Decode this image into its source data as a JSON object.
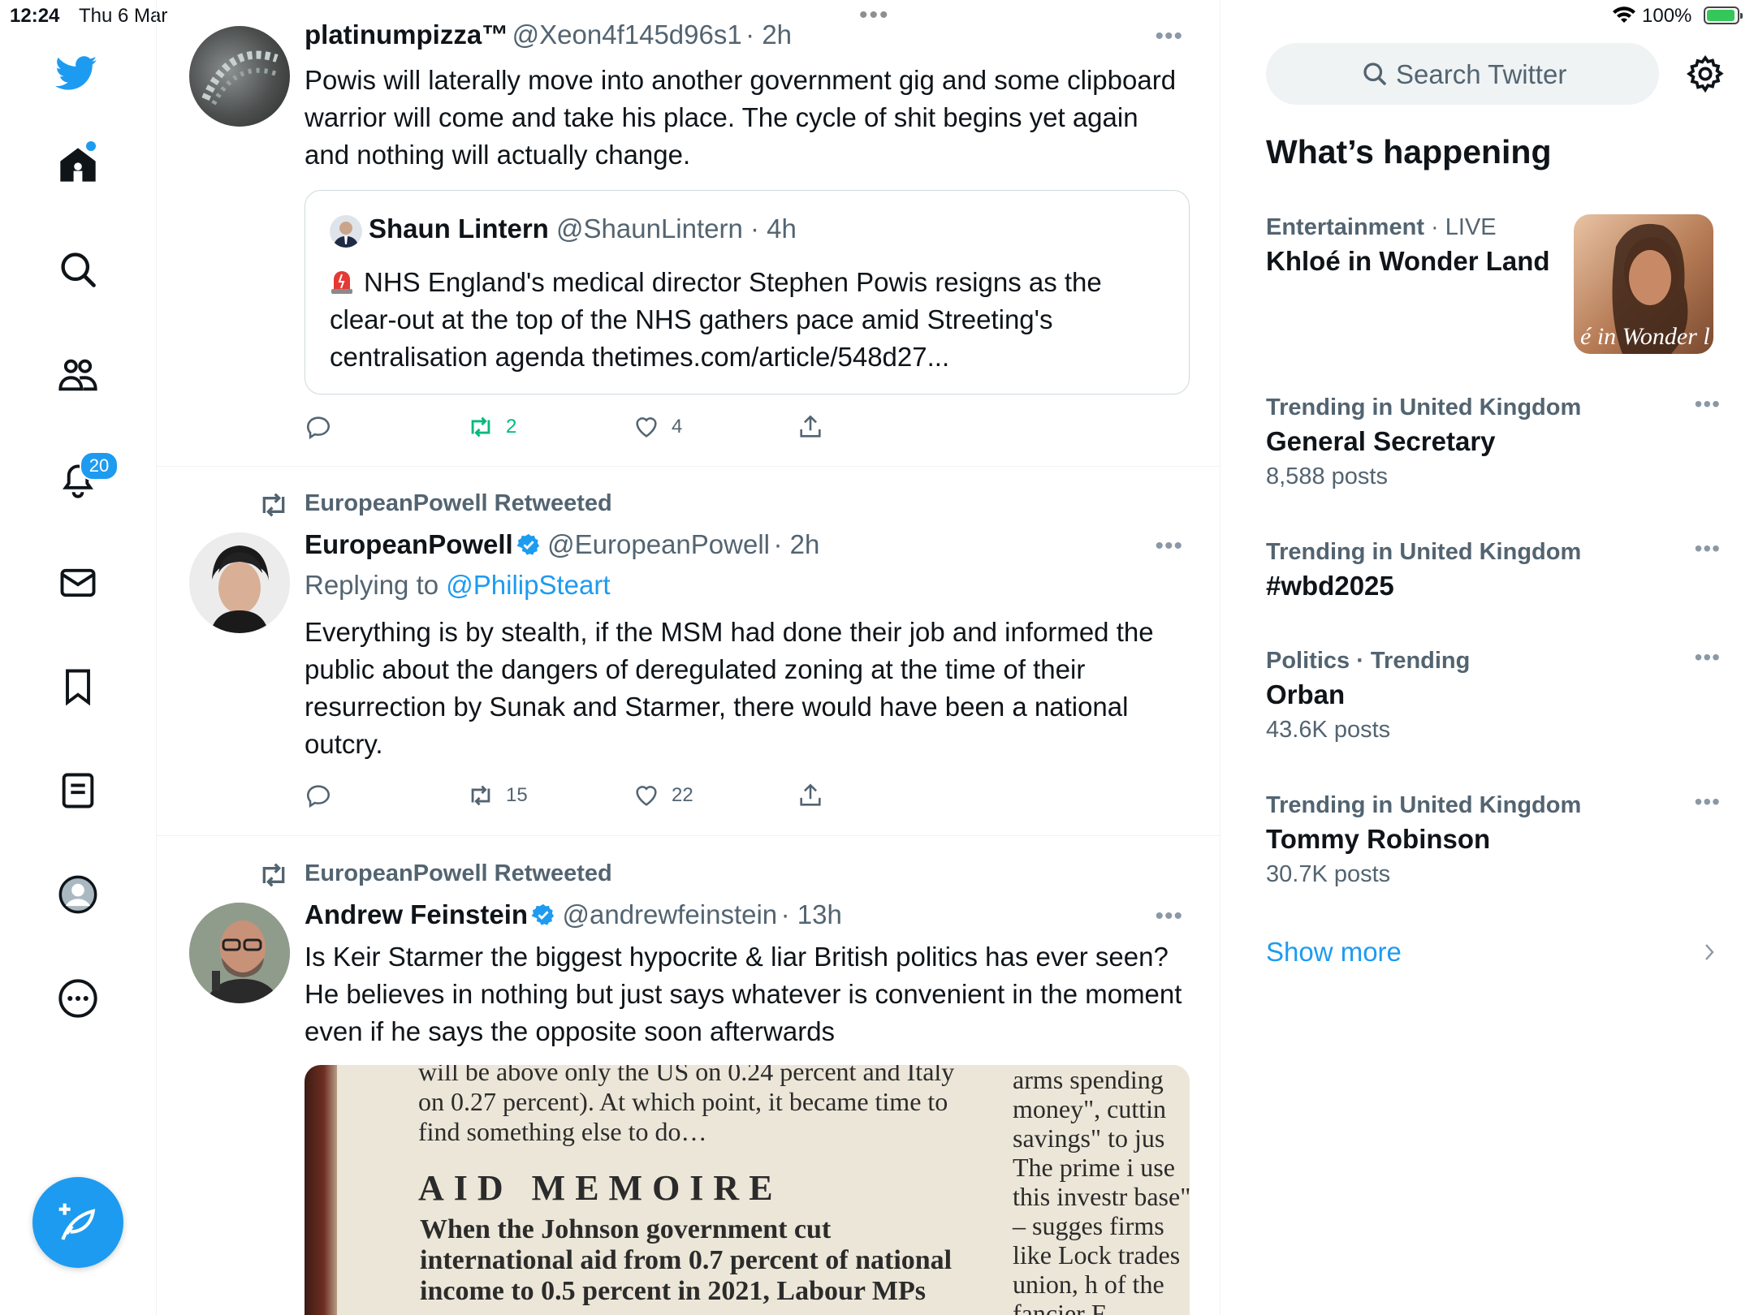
{
  "status_bar": {
    "time": "12:24",
    "date": "Thu 6 Mar",
    "multitask_dots": "•••",
    "battery_text": "100%",
    "battery_level_percent": 100
  },
  "nav": {
    "notifications_badge": "20",
    "accent_color": "#1d9bf0"
  },
  "tweets": [
    {
      "name": "platinumpizza™",
      "handle": "@Xeon4f145d96s1",
      "time": "· 2h",
      "text": "Powis will laterally move into another government gig and some clipboard warrior will come and take his place. The cycle of shit begins yet again and nothing will actually change.",
      "quote": {
        "name": "Shaun Lintern",
        "handle": "@ShaunLintern",
        "time": "· 4h",
        "text": "NHS England's medical director Stephen Powis resigns as the clear-out at the top of the NHS gathers pace amid Streeting's centralisation agenda thetimes.com/article/548d27..."
      },
      "retweets": "2",
      "likes": "4"
    },
    {
      "retweeted_by": "EuropeanPowell Retweeted",
      "name": "EuropeanPowell",
      "handle": "@EuropeanPowell",
      "time": "· 2h",
      "replying_prefix": "Replying to",
      "replying_to": "@PhilipSteart",
      "text": "Everything is by stealth, if the MSM had done their job and informed the public about the dangers of deregulated zoning at the time of their resurrection by Sunak and Starmer, there would have been a national outcry.",
      "retweets": "15",
      "likes": "22"
    },
    {
      "retweeted_by": "EuropeanPowell Retweeted",
      "name": "Andrew Feinstein",
      "handle": "@andrewfeinstein",
      "time": "· 13h",
      "text": "Is Keir Starmer the biggest hypocrite & liar British politics has ever seen? He believes in nothing but just says whatever is convenient in the moment even if he says the opposite soon afterwards",
      "media": {
        "col1": "will be above only the US on 0.24 percent and Italy on 0.27 percent). At which point, it became time to find something else to do…",
        "heading": "AID MEMOIRE",
        "when": "When the Johnson government cut international aid from 0.7 percent of national income to 0.5 percent in 2021, Labour MPs",
        "col2": "arms spending money\", cuttin savings\" to jus The prime i use this investr base\" – sugges firms like Lock trades union, h of the fancier F"
      }
    }
  ],
  "sidebar": {
    "search_placeholder": "Search Twitter",
    "title": "What’s happening",
    "trends": [
      {
        "category": "Entertainment",
        "sep": " · ",
        "status": "LIVE",
        "name": "Khloé in Wonder Land",
        "posts": "",
        "image_text": "é in Wonder l"
      },
      {
        "category": "Trending in United Kingdom",
        "name": "General Secretary",
        "posts": "8,588 posts"
      },
      {
        "category": "Trending in United Kingdom",
        "name": "#wbd2025",
        "posts": ""
      },
      {
        "category": "Politics · Trending",
        "name": "Orban",
        "posts": "43.6K posts"
      },
      {
        "category": "Trending in United Kingdom",
        "name": "Tommy Robinson",
        "posts": "30.7K posts"
      }
    ],
    "show_more": "Show more"
  }
}
